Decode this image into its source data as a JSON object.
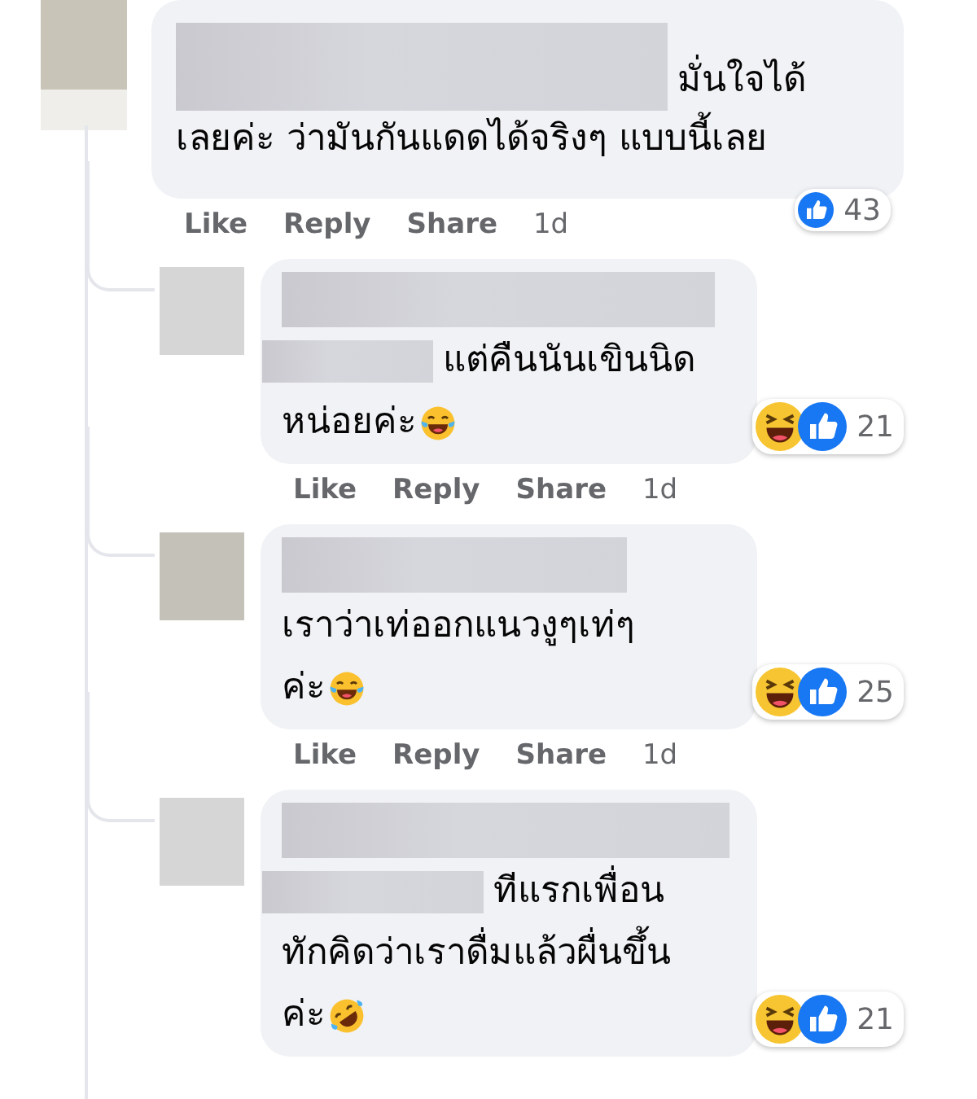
{
  "comment": {
    "lines": [
      {
        "text": "มั่นใจได้",
        "hidden_before": true
      },
      {
        "text": "เลยค่ะ ว่ามันกันแดดได้จริงๆ แบบนี้เลย",
        "hidden_before": false
      }
    ],
    "reactions": {
      "kinds": [
        {
          "kind": "like"
        }
      ],
      "count": "43"
    },
    "actions": [
      "Like",
      "Reply",
      "Share"
    ],
    "time": "1d"
  },
  "replies": [
    {
      "name_hidden": true,
      "lines": [
        {
          "text": "แต่คืนนันเขินนิด",
          "hidden_before": true
        },
        {
          "text": "หน่อยค่ะ",
          "hidden_before": false,
          "emoji": {
            "kind": "tears-of-joy"
          }
        }
      ],
      "reactions": {
        "kinds": [
          {
            "kind": "haha"
          },
          {
            "kind": "like"
          }
        ],
        "count": "21"
      },
      "actions": [
        "Like",
        "Reply",
        "Share"
      ],
      "time": "1d"
    },
    {
      "name_hidden": true,
      "lines": [
        {
          "text": "เราว่าเท่ออกแนวงูๆเท่ๆ",
          "hidden_before": false
        },
        {
          "text": "ค่ะ",
          "hidden_before": false,
          "emoji": {
            "kind": "tears-of-joy"
          }
        }
      ],
      "reactions": {
        "kinds": [
          {
            "kind": "haha"
          },
          {
            "kind": "like"
          }
        ],
        "count": "25"
      },
      "actions": [
        "Like",
        "Reply",
        "Share"
      ],
      "time": "1d"
    },
    {
      "name_hidden": true,
      "lines": [
        {
          "text": "ทีแรกเพื่อน",
          "hidden_before": true
        },
        {
          "text": "ทักคิดว่าเราดื่มแล้วผื่นขึ้น",
          "hidden_before": false
        },
        {
          "text": "ค่ะ",
          "hidden_before": false,
          "emoji": {
            "kind": "rolling-laughing"
          }
        }
      ],
      "reactions": {
        "kinds": [
          {
            "kind": "haha"
          },
          {
            "kind": "like"
          }
        ],
        "count": "21"
      }
    }
  ]
}
